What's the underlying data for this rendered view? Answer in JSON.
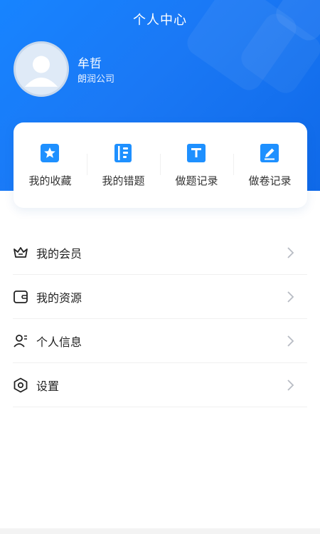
{
  "header": {
    "title": "个人中心",
    "user": {
      "name": "牟哲",
      "company": "朗润公司"
    }
  },
  "quick_actions": [
    {
      "label": "我的收藏",
      "icon": "star-icon"
    },
    {
      "label": "我的错题",
      "icon": "notebook-icon"
    },
    {
      "label": "做题记录",
      "icon": "record-icon"
    },
    {
      "label": "做卷记录",
      "icon": "pencil-icon"
    }
  ],
  "menu": [
    {
      "label": "我的会员",
      "icon": "crown-icon"
    },
    {
      "label": "我的资源",
      "icon": "wallet-icon"
    },
    {
      "label": "个人信息",
      "icon": "user-icon"
    },
    {
      "label": "设置",
      "icon": "settings-icon"
    }
  ],
  "colors": {
    "accent": "#1a78f5",
    "icon_blue": "#1e90ff",
    "chevron": "#b8bcc4"
  }
}
